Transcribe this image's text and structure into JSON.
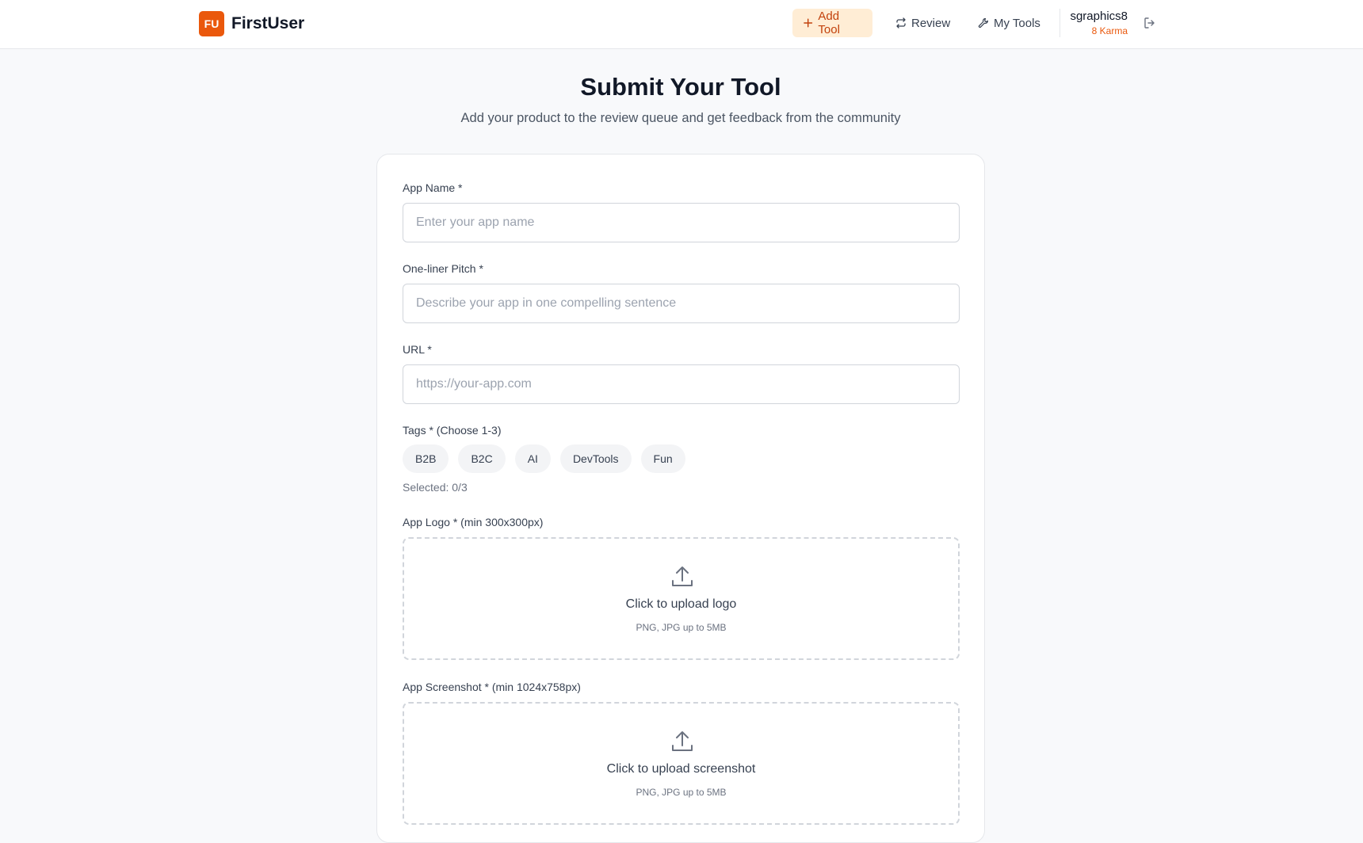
{
  "brand": {
    "badge": "FU",
    "name": "FirstUser"
  },
  "nav": {
    "add_tool": "Add Tool",
    "review": "Review",
    "my_tools": "My Tools"
  },
  "user": {
    "name": "sgraphics8",
    "karma": "8 Karma"
  },
  "page": {
    "title": "Submit Your Tool",
    "subtitle": "Add your product to the review queue and get feedback from the community"
  },
  "form": {
    "app_name": {
      "label": "App Name *",
      "placeholder": "Enter your app name",
      "value": ""
    },
    "pitch": {
      "label": "One-liner Pitch *",
      "placeholder": "Describe your app in one compelling sentence",
      "value": ""
    },
    "url": {
      "label": "URL *",
      "placeholder": "https://your-app.com",
      "value": ""
    },
    "tags": {
      "label": "Tags * (Choose 1-3)",
      "options": [
        "B2B",
        "B2C",
        "AI",
        "DevTools",
        "Fun"
      ],
      "selected_text": "Selected: 0/3"
    },
    "logo": {
      "label": "App Logo * (min 300x300px)",
      "cta": "Click to upload logo",
      "hint": "PNG, JPG up to 5MB"
    },
    "screenshot": {
      "label": "App Screenshot * (min 1024x758px)",
      "cta": "Click to upload screenshot",
      "hint": "PNG, JPG up to 5MB"
    }
  },
  "colors": {
    "accent": "#ea580c",
    "accent_soft": "#ffedd5",
    "background": "#f8f9fb"
  },
  "icons": {
    "add": "plus-icon",
    "review": "repeat-icon",
    "my_tools": "wrench-icon",
    "logout": "logout-icon",
    "upload": "upload-icon"
  }
}
